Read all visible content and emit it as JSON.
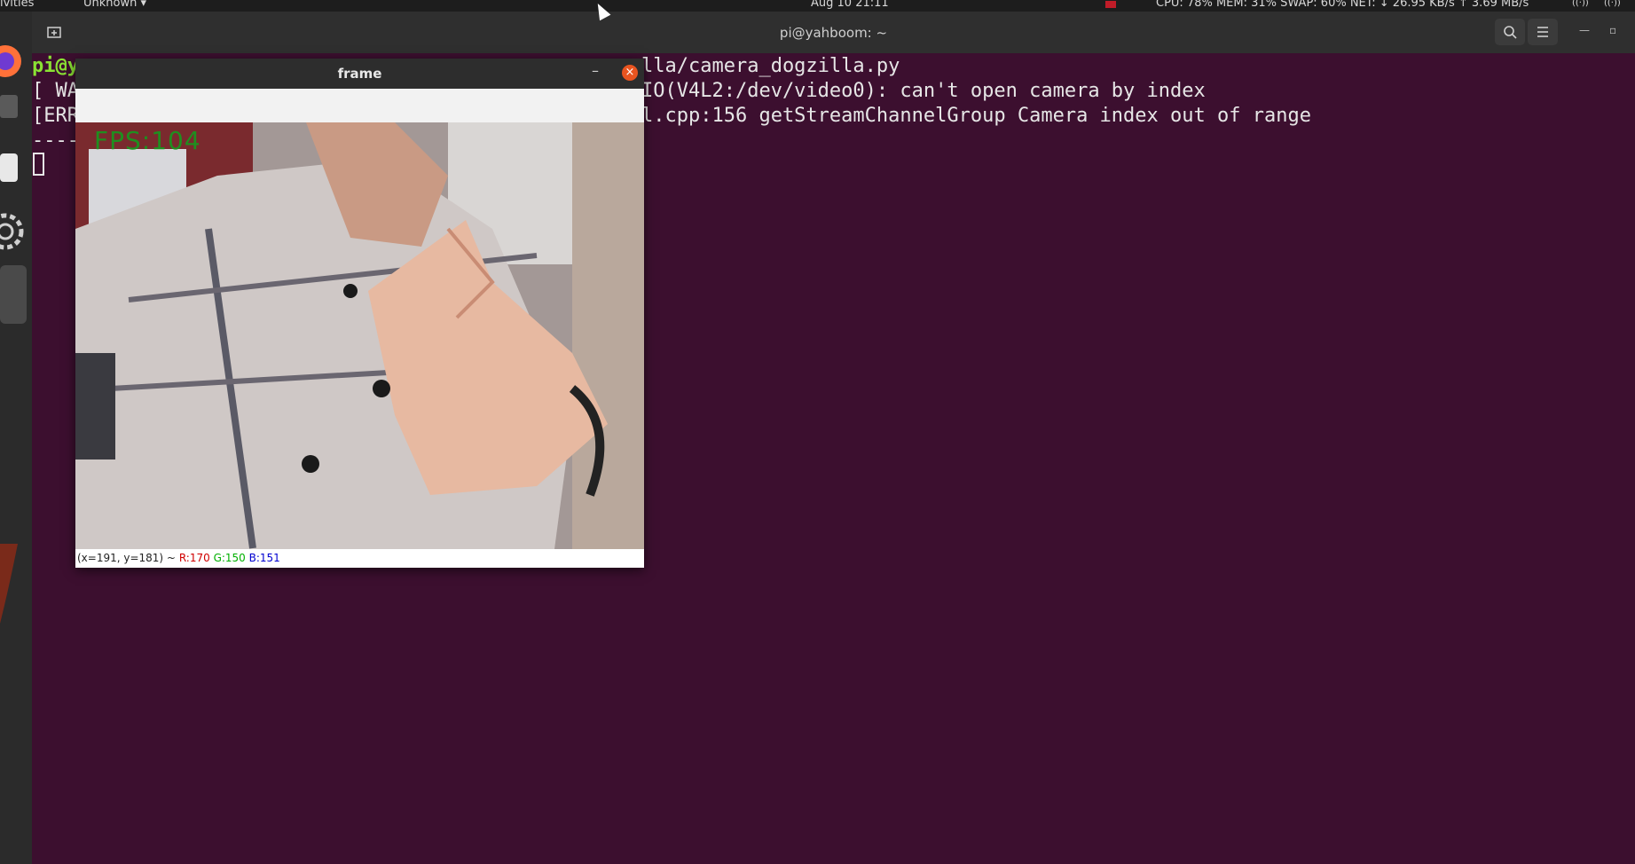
{
  "topbar": {
    "activities": "ivities",
    "app_menu": "Unknown ▾",
    "clock": "Aug 10 21:11",
    "stats": "CPU: 78% MEM: 31% SWAP: 60% NET: ↓ 26.95 KB/s ↑ 3.69 MB/s"
  },
  "terminal": {
    "title": "pi@yahboom: ~",
    "lines": [
      "pi@y",
      "[ WA",
      "[ERR",
      "----"
    ],
    "right_lines": [
      "lla/camera_dogzilla.py",
      "IO(V4L2:/dev/video0): can't open camera by index",
      "l.cpp:156 getStreamChannelGroup Camera index out of range"
    ],
    "search_icon": "search-icon",
    "menu_icon": "hamburger-icon"
  },
  "frame_window": {
    "title": "frame",
    "minimize": "–",
    "close": "×",
    "fps_overlay": "FPS:104",
    "status": {
      "coords": "(x=191, y=181) ~",
      "r": "R:170",
      "g": "G:150",
      "b": "B:151"
    }
  },
  "colors": {
    "terminal_bg": "#3c0f2f",
    "prompt_green": "#8ae234",
    "close_orange": "#e95420",
    "fps_green": "#1f8f1f"
  }
}
